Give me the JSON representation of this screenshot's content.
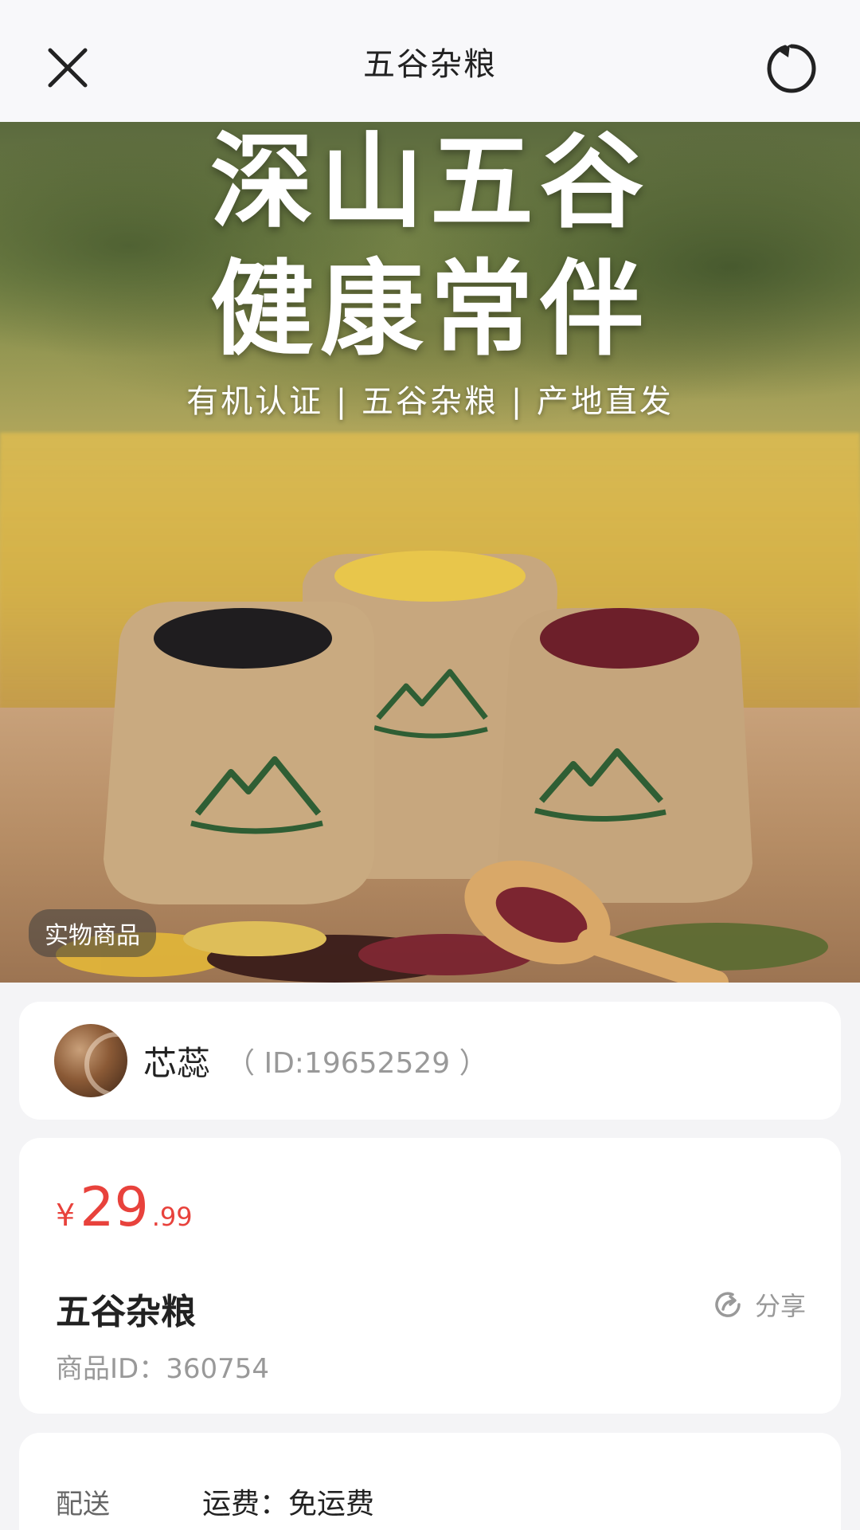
{
  "header": {
    "title": "五谷杂粮",
    "close_icon": "close-icon",
    "refresh_icon": "refresh-icon"
  },
  "hero": {
    "title_line1": "深山五谷",
    "title_line2": "健康常伴",
    "subtitle": "有机认证 | 五谷杂粮 | 产地直发",
    "badge": "实物商品",
    "logo_color": "#2f5e34"
  },
  "seller": {
    "name": "芯蕊",
    "id_text": "（ ID:19652529 ）"
  },
  "product": {
    "price_currency": "¥",
    "price_integer": "29",
    "price_decimal": ".99",
    "price_color": "#e8423c",
    "name": "五谷杂粮",
    "id_text": "商品ID：360754",
    "share_label": "分享",
    "share_icon": "share-icon"
  },
  "delivery": {
    "label": "配送",
    "value": "运费：免运费"
  }
}
